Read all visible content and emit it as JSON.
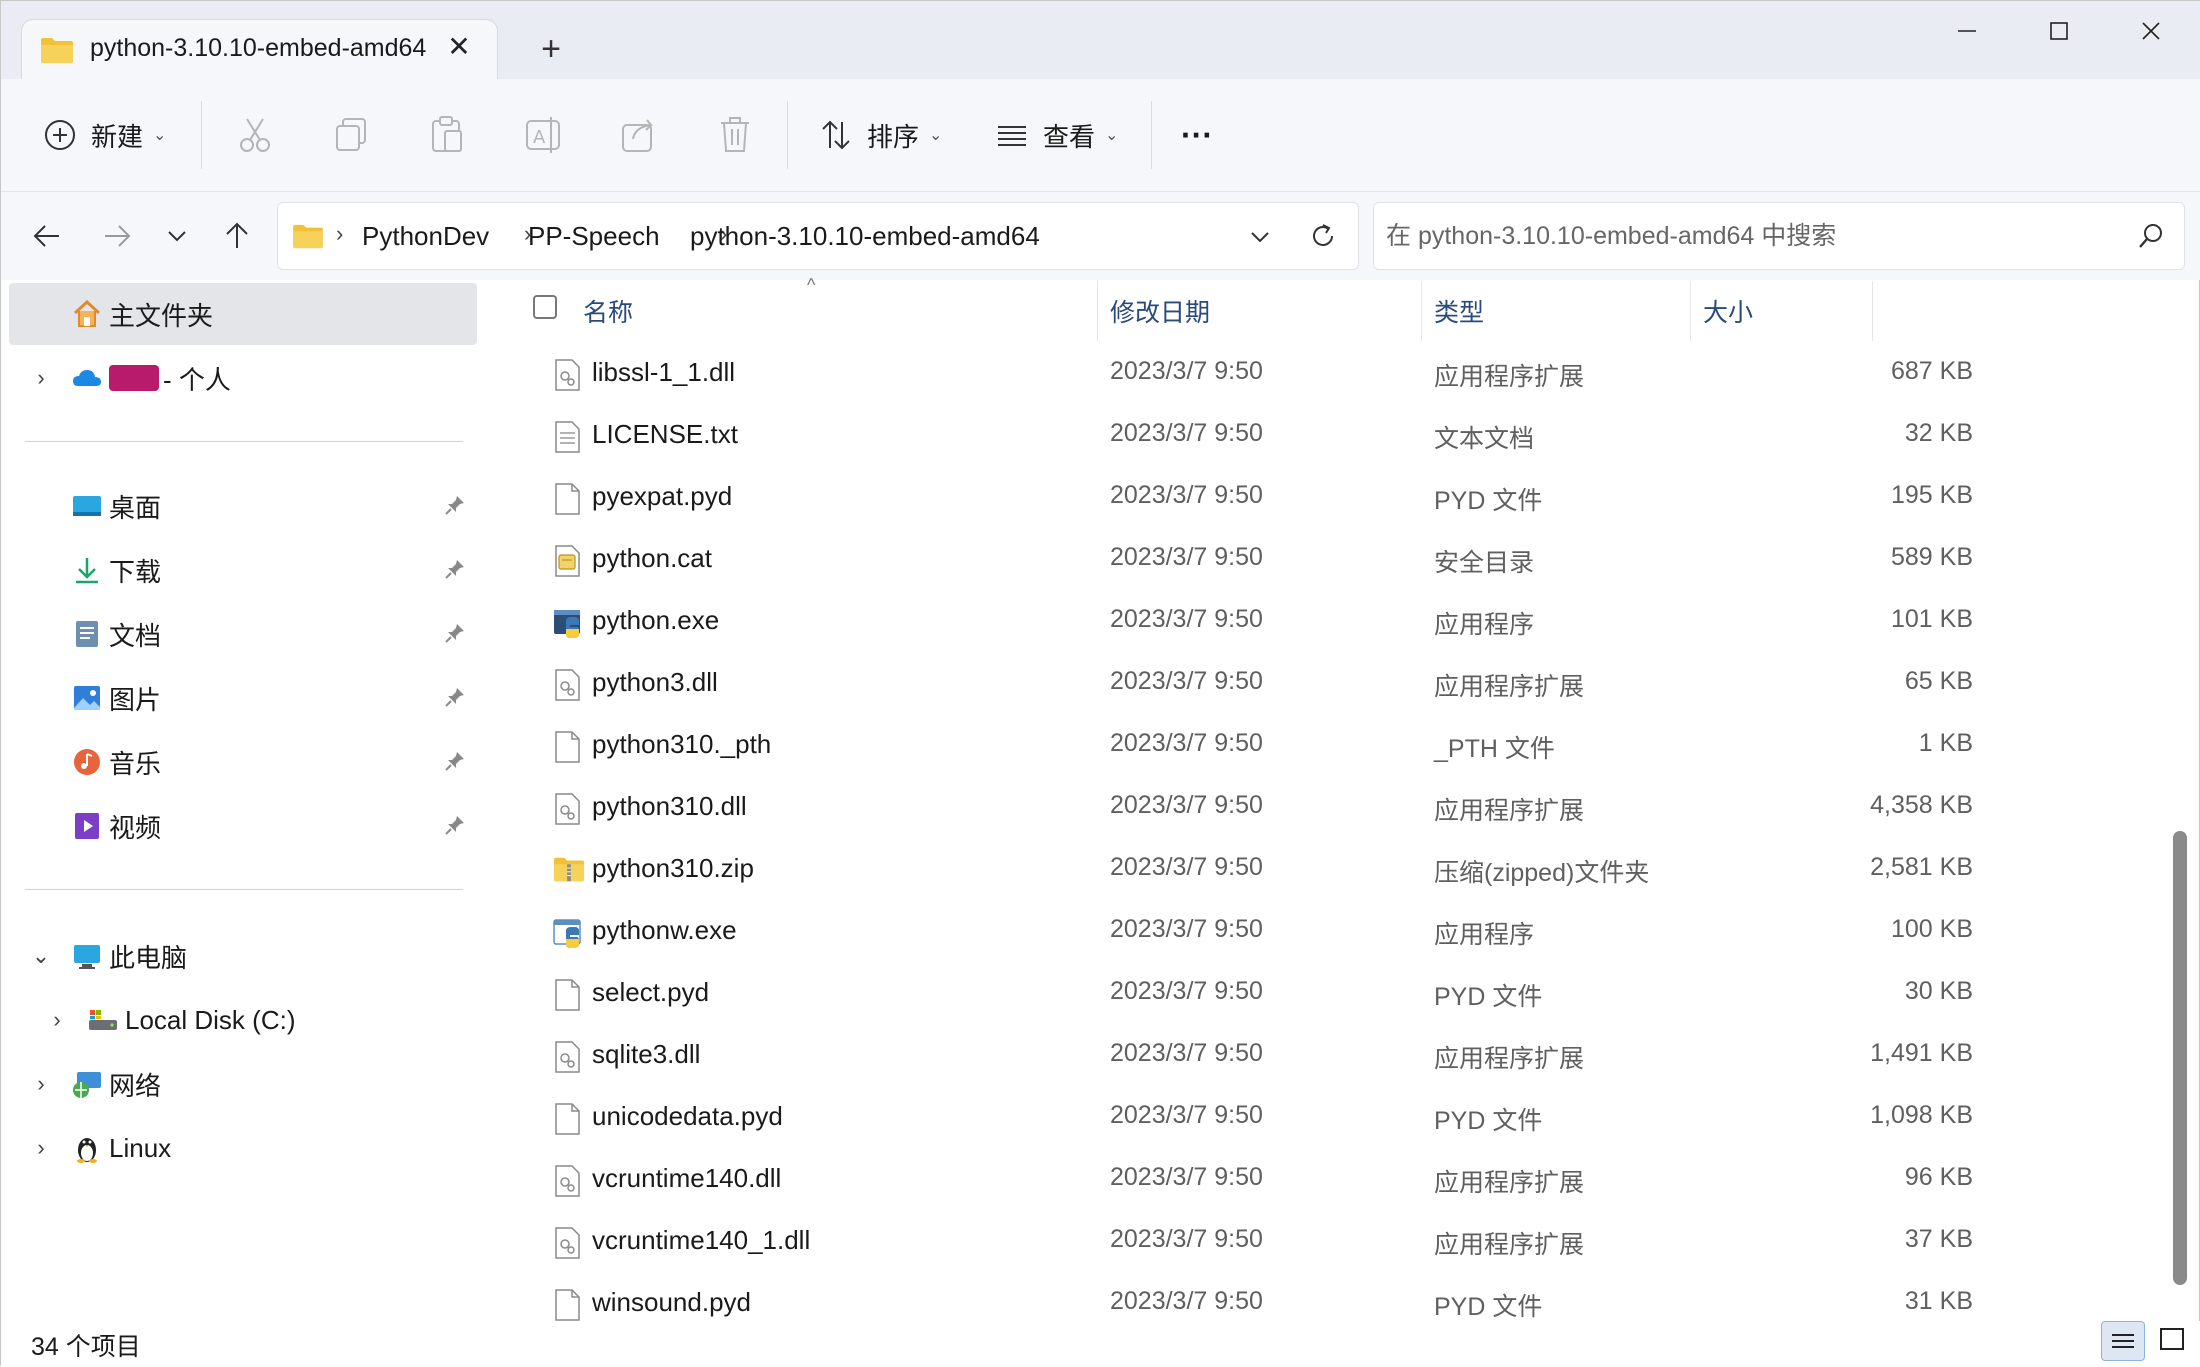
{
  "tab": {
    "title": "python-3.10.10-embed-amd64",
    "close": "✕",
    "new": "+"
  },
  "window_controls": {
    "minimize": "—",
    "maximize": "☐",
    "close": "✕"
  },
  "toolbar": {
    "new_label": "新建",
    "sort_label": "排序",
    "view_label": "查看",
    "more_label": "···"
  },
  "breadcrumb": [
    "PythonDev",
    "PP-Speech",
    "python-3.10.10-embed-amd64"
  ],
  "search": {
    "placeholder": "在 python-3.10.10-embed-amd64 中搜索"
  },
  "sidebar": {
    "home": "主文件夹",
    "onedrive": "- 个人",
    "quick": [
      {
        "label": "桌面",
        "icon": "desktop-icon"
      },
      {
        "label": "下载",
        "icon": "download-icon"
      },
      {
        "label": "文档",
        "icon": "documents-icon"
      },
      {
        "label": "图片",
        "icon": "pictures-icon"
      },
      {
        "label": "音乐",
        "icon": "music-icon"
      },
      {
        "label": "视频",
        "icon": "videos-icon"
      }
    ],
    "this_pc": "此电脑",
    "local_disk": "Local Disk (C:)",
    "network": "网络",
    "linux": "Linux"
  },
  "columns": {
    "name": "名称",
    "date": "修改日期",
    "type": "类型",
    "size": "大小"
  },
  "files": [
    {
      "name": "libssl-1_1.dll",
      "date": "2023/3/7 9:50",
      "type": "应用程序扩展",
      "size": "687 KB",
      "icon": "dll"
    },
    {
      "name": "LICENSE.txt",
      "date": "2023/3/7 9:50",
      "type": "文本文档",
      "size": "32 KB",
      "icon": "txt"
    },
    {
      "name": "pyexpat.pyd",
      "date": "2023/3/7 9:50",
      "type": "PYD 文件",
      "size": "195 KB",
      "icon": "file"
    },
    {
      "name": "python.cat",
      "date": "2023/3/7 9:50",
      "type": "安全目录",
      "size": "589 KB",
      "icon": "cat"
    },
    {
      "name": "python.exe",
      "date": "2023/3/7 9:50",
      "type": "应用程序",
      "size": "101 KB",
      "icon": "exe"
    },
    {
      "name": "python3.dll",
      "date": "2023/3/7 9:50",
      "type": "应用程序扩展",
      "size": "65 KB",
      "icon": "dll"
    },
    {
      "name": "python310._pth",
      "date": "2023/3/7 9:50",
      "type": "_PTH 文件",
      "size": "1 KB",
      "icon": "file"
    },
    {
      "name": "python310.dll",
      "date": "2023/3/7 9:50",
      "type": "应用程序扩展",
      "size": "4,358 KB",
      "icon": "dll"
    },
    {
      "name": "python310.zip",
      "date": "2023/3/7 9:50",
      "type": "压缩(zipped)文件夹",
      "size": "2,581 KB",
      "icon": "zip"
    },
    {
      "name": "pythonw.exe",
      "date": "2023/3/7 9:50",
      "type": "应用程序",
      "size": "100 KB",
      "icon": "exew"
    },
    {
      "name": "select.pyd",
      "date": "2023/3/7 9:50",
      "type": "PYD 文件",
      "size": "30 KB",
      "icon": "file"
    },
    {
      "name": "sqlite3.dll",
      "date": "2023/3/7 9:50",
      "type": "应用程序扩展",
      "size": "1,491 KB",
      "icon": "dll"
    },
    {
      "name": "unicodedata.pyd",
      "date": "2023/3/7 9:50",
      "type": "PYD 文件",
      "size": "1,098 KB",
      "icon": "file"
    },
    {
      "name": "vcruntime140.dll",
      "date": "2023/3/7 9:50",
      "type": "应用程序扩展",
      "size": "96 KB",
      "icon": "dll"
    },
    {
      "name": "vcruntime140_1.dll",
      "date": "2023/3/7 9:50",
      "type": "应用程序扩展",
      "size": "37 KB",
      "icon": "dll"
    },
    {
      "name": "winsound.pyd",
      "date": "2023/3/7 9:50",
      "type": "PYD 文件",
      "size": "31 KB",
      "icon": "file"
    }
  ],
  "status": {
    "count": "34 个项目"
  },
  "colors": {
    "folder": "#f2c13a",
    "accent": "#0067c0",
    "header_text": "#2a4a7a",
    "selected_bg": "#e3e5e9"
  }
}
